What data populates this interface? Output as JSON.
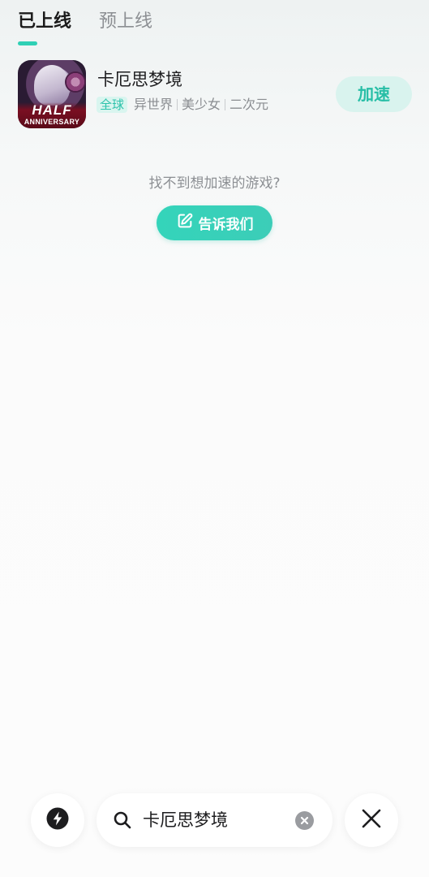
{
  "tabs": [
    {
      "label": "已上线",
      "active": true
    },
    {
      "label": "预上线",
      "active": false
    }
  ],
  "game": {
    "title": "卡厄思梦境",
    "region": "全球",
    "tags": [
      "异世界",
      "美少女",
      "二次元"
    ],
    "icon_text_top": "HALF",
    "icon_text_bottom": "ANNIVERSARY",
    "action_label": "加速"
  },
  "empty_prompt": "找不到想加速的游戏?",
  "tell_us_label": "告诉我们",
  "search": {
    "value": "卡厄思梦境"
  },
  "colors": {
    "accent": "#2fd0b5",
    "accent_light": "#d9f3ee"
  },
  "icons": {
    "boost": "lightning-icon",
    "search": "search-icon",
    "clear": "clear-icon",
    "close": "close-icon",
    "edit": "edit-icon"
  }
}
